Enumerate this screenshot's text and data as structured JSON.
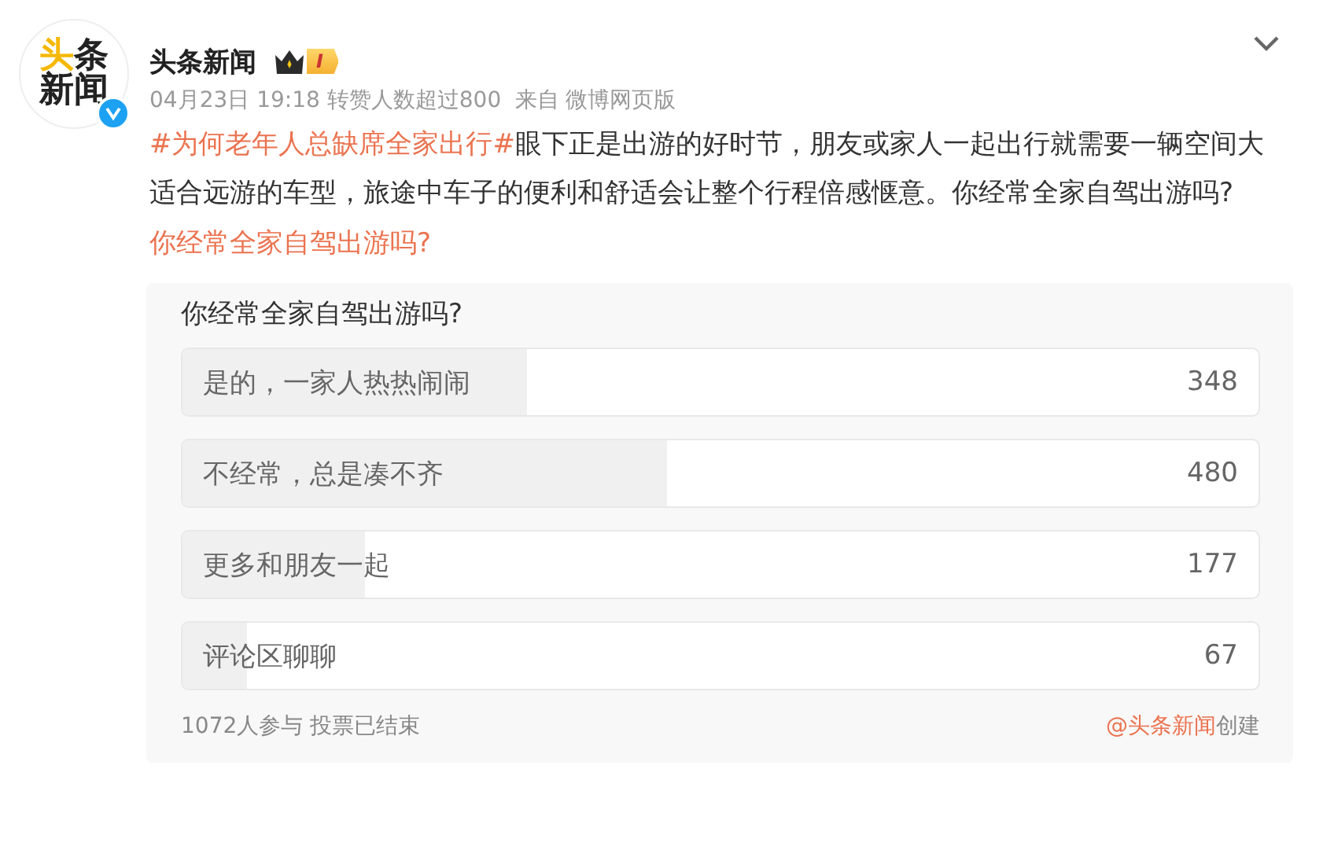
{
  "post": {
    "author": "头条新闻",
    "avatar_text": [
      "头",
      "条",
      "新闻"
    ],
    "verified": true,
    "level_badge": "I",
    "meta": "04月23日 19:18 转赞人数超过800",
    "source_prefix": "来自",
    "source": "微博网页版",
    "hashtag": "#为何老年人总缺席全家出行#",
    "body": "眼下正是出游的好时节，朋友或家人一起出行就需要一辆空间大适合远游的车型，旅途中车子的便利和舒适会让整个行程倍感惬意。你经常全家自驾出游吗?",
    "link": "你经常全家自驾出游吗?"
  },
  "poll": {
    "question": "你经常全家自驾出游吗?",
    "options": [
      {
        "label": "是的，一家人热热闹闹",
        "count": "348",
        "level": 0.32
      },
      {
        "label": "不经常，总是凑不齐",
        "count": "480",
        "level": 0.45
      },
      {
        "label": "更多和朋友一起",
        "count": "177",
        "level": 0.17
      },
      {
        "label": "评论区聊聊",
        "count": "67",
        "level": 0.06
      }
    ],
    "summary": "1072人参与 投票已结束",
    "creator": "@头条新闻",
    "creator_suffix": "创建"
  }
}
